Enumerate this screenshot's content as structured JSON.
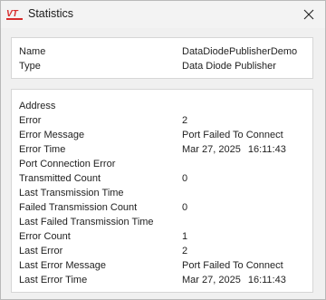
{
  "window": {
    "title": "Statistics",
    "icon": "vt-logo-icon",
    "logo_text": "VT",
    "accent_color": "#d72b2b"
  },
  "summary": [
    {
      "label": "Name",
      "value": "DataDiodePublisherDemo"
    },
    {
      "label": "Type",
      "value": "Data Diode Publisher"
    }
  ],
  "stats": [
    {
      "label": "Address",
      "value": ""
    },
    {
      "label": "Error",
      "value": "2"
    },
    {
      "label": "Error Message",
      "value": "Port Failed To Connect"
    },
    {
      "label": "Error Time",
      "value": "Mar 27, 2025",
      "time": "16:11:43"
    },
    {
      "label": "Port Connection Error",
      "value": ""
    },
    {
      "label": "Transmitted Count",
      "value": "0"
    },
    {
      "label": "Last Transmission Time",
      "value": ""
    },
    {
      "label": "Failed Transmission Count",
      "value": "0"
    },
    {
      "label": "Last Failed Transmission Time",
      "value": ""
    },
    {
      "label": "Error Count",
      "value": "1"
    },
    {
      "label": "Last Error",
      "value": "2"
    },
    {
      "label": "Last Error Message",
      "value": "Port Failed To Connect"
    },
    {
      "label": "Last Error Time",
      "value": "Mar 27, 2025",
      "time": "16:11:43"
    }
  ]
}
